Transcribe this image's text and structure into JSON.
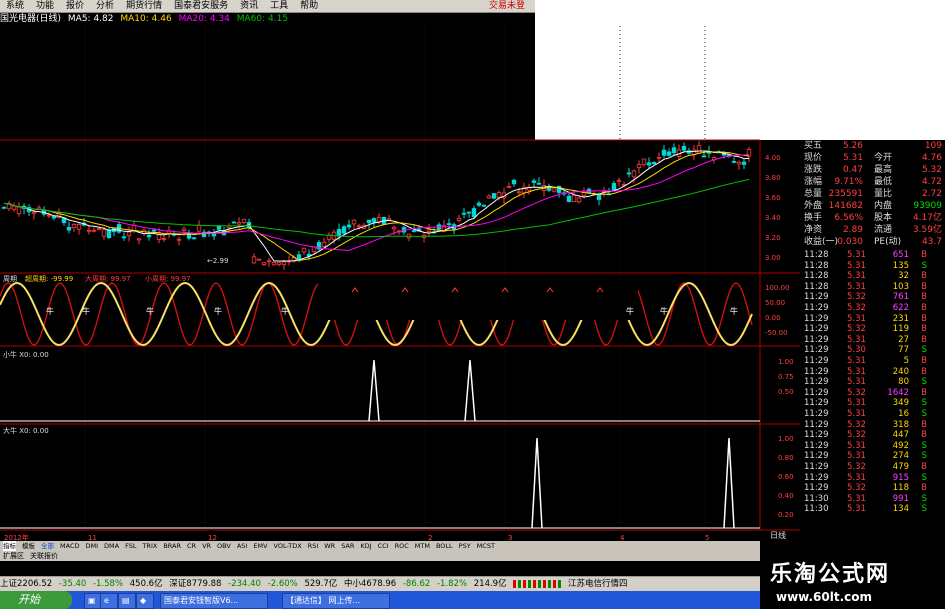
{
  "menu": {
    "items": [
      "系统",
      "功能",
      "报价",
      "分析",
      "期货行情",
      "国泰君安服务",
      "资讯",
      "工具",
      "帮助"
    ],
    "trade": "交易未登"
  },
  "stock": {
    "name": "国光电器(日线)",
    "ma5": "MA5: 4.82",
    "ma10": "MA10: 4.46",
    "ma20": "MA20: 4.34",
    "ma60": "MA60: 4.15",
    "low_mark": "←2.99",
    "price_ticks": [
      "4.00",
      "3.80",
      "3.60",
      "3.40",
      "3.20",
      "3.00"
    ]
  },
  "panels": {
    "cycle_label": "周期",
    "cycle_vals": [
      "超周期: -99.99",
      "大周期: 99.97",
      "小周期: 99.97"
    ],
    "cycle_ticks": [
      "100.00",
      "50.00",
      "0.00",
      "-50.00"
    ],
    "small_cow": "小牛 X0: 0.00",
    "small_ticks": [
      "1.00",
      "0.75",
      "0.50"
    ],
    "big_cow": "大牛 X0: 0.00",
    "big_ticks": [
      "1.00",
      "0.80",
      "0.60",
      "0.40",
      "0.20"
    ],
    "cow_glyph": "牛",
    "date_axis": [
      "2012年",
      "11",
      "12",
      "2",
      "3",
      "4",
      "5"
    ],
    "riday": "日线"
  },
  "quote": [
    {
      "l": "买五",
      "v": "5.26",
      "l2": "",
      "v2": "109"
    },
    {
      "l": "现价",
      "v": "5.31",
      "l2": "今开",
      "v2": "4.76"
    },
    {
      "l": "涨跌",
      "v": "0.47",
      "l2": "最高",
      "v2": "5.32"
    },
    {
      "l": "涨幅",
      "v": "9.71%",
      "l2": "最低",
      "v2": "4.72"
    },
    {
      "l": "总量",
      "v": "235591",
      "l2": "量比",
      "v2": "2.72"
    },
    {
      "l": "外盘",
      "v": "141682",
      "l2": "内盘",
      "v2": "93909"
    },
    {
      "l": "换手",
      "v": "6.56%",
      "l2": "股本",
      "v2": "4.17亿"
    },
    {
      "l": "净资",
      "v": "2.89",
      "l2": "流通",
      "v2": "3.59亿"
    },
    {
      "l": "收益(一)",
      "v": "0.030",
      "l2": "PE(动)",
      "v2": "43.7"
    }
  ],
  "ticks": [
    {
      "t": "11:28",
      "p": "5.31",
      "v": "651",
      "s": "B"
    },
    {
      "t": "11:28",
      "p": "5.31",
      "v": "135",
      "s": "S"
    },
    {
      "t": "11:28",
      "p": "5.31",
      "v": "32",
      "s": "B"
    },
    {
      "t": "11:28",
      "p": "5.31",
      "v": "103",
      "s": "B"
    },
    {
      "t": "11:29",
      "p": "5.32",
      "v": "761",
      "s": "B"
    },
    {
      "t": "11:29",
      "p": "5.32",
      "v": "622",
      "s": "B"
    },
    {
      "t": "11:29",
      "p": "5.31",
      "v": "231",
      "s": "B"
    },
    {
      "t": "11:29",
      "p": "5.32",
      "v": "119",
      "s": "B"
    },
    {
      "t": "11:29",
      "p": "5.31",
      "v": "27",
      "s": "B"
    },
    {
      "t": "11:29",
      "p": "5.30",
      "v": "77",
      "s": "S"
    },
    {
      "t": "11:29",
      "p": "5.31",
      "v": "5",
      "s": "B"
    },
    {
      "t": "11:29",
      "p": "5.31",
      "v": "240",
      "s": "B"
    },
    {
      "t": "11:29",
      "p": "5.31",
      "v": "80",
      "s": "S"
    },
    {
      "t": "11:29",
      "p": "5.32",
      "v": "1642",
      "s": "B"
    },
    {
      "t": "11:29",
      "p": "5.31",
      "v": "349",
      "s": "S"
    },
    {
      "t": "11:29",
      "p": "5.31",
      "v": "16",
      "s": "S"
    },
    {
      "t": "11:29",
      "p": "5.32",
      "v": "318",
      "s": "B"
    },
    {
      "t": "11:29",
      "p": "5.32",
      "v": "447",
      "s": "B"
    },
    {
      "t": "11:29",
      "p": "5.31",
      "v": "492",
      "s": "S"
    },
    {
      "t": "11:29",
      "p": "5.31",
      "v": "274",
      "s": "S"
    },
    {
      "t": "11:29",
      "p": "5.32",
      "v": "479",
      "s": "B"
    },
    {
      "t": "11:29",
      "p": "5.31",
      "v": "915",
      "s": "S"
    },
    {
      "t": "11:29",
      "p": "5.32",
      "v": "118",
      "s": "B"
    },
    {
      "t": "11:30",
      "p": "5.31",
      "v": "991",
      "s": "S"
    },
    {
      "t": "11:30",
      "p": "5.31",
      "v": "134",
      "s": "S"
    }
  ],
  "indicators": [
    "指标",
    "模板",
    "全部",
    "MACD",
    "DMI",
    "DMA",
    "FSL",
    "TRIX",
    "BRAR",
    "CR",
    "VR",
    "OBV",
    "ASI",
    "EMV",
    "VOL-TDX",
    "RSI",
    "WR",
    "SAR",
    "KDJ",
    "CCI",
    "ROC",
    "MTM",
    "BOLL",
    "PSY",
    "MCST"
  ],
  "extbar": [
    "扩展区",
    "关联报价"
  ],
  "status": {
    "sh": "上证2206.52",
    "sh_chg": "-35.40",
    "sh_pct": "-1.58%",
    "sh_amt": "450.6亿",
    "sz": "深证8779.88",
    "sz_chg": "-234.40",
    "sz_pct": "-2.60%",
    "sz_amt": "529.7亿",
    "zx": "中小4678.96",
    "zx_chg": "-86.62",
    "zx_pct": "-1.82%",
    "zx_amt": "214.9亿",
    "server": "江苏电信行情四"
  },
  "taskbar": {
    "start": "开始",
    "items": [
      "国泰君安钱智版V6...",
      "【通达信】 网上传..."
    ]
  },
  "brand": {
    "name": "乐淘公式网",
    "url": "www.60lt.com"
  },
  "colors": {
    "up": "#ff3b3b",
    "down": "#00d8d8",
    "ma5": "#ffffff",
    "ma10": "#ffd800",
    "ma20": "#ff00ff",
    "ma60": "#00c000",
    "frame": "#b00000",
    "sine_red": "#d01010",
    "sine_yellow": "#f8e060"
  }
}
